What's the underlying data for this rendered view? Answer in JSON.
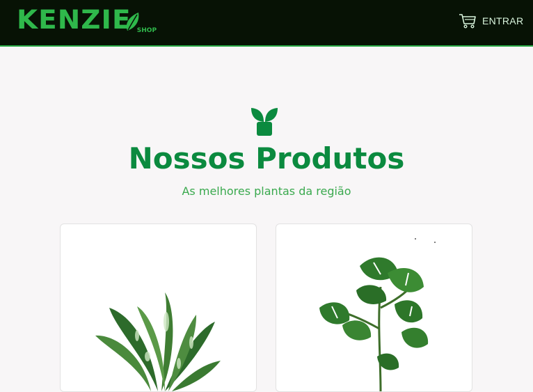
{
  "header": {
    "logo_text": "KENZIE",
    "logo_sub": "SHOP",
    "login_label": "ENTRAR"
  },
  "hero": {
    "title": "Nossos Produtos",
    "subtitle": "As melhores plantas da região"
  },
  "products": [
    {
      "image_icon": "aglaonema-plant-image"
    },
    {
      "image_icon": "monstera-plant-image"
    }
  ],
  "colors": {
    "header_bg": "#071205",
    "brand_green": "#2fb84b",
    "title_green": "#0b8a3f",
    "subtitle_green": "#3aa94e",
    "page_bg": "#f8f6f7"
  }
}
